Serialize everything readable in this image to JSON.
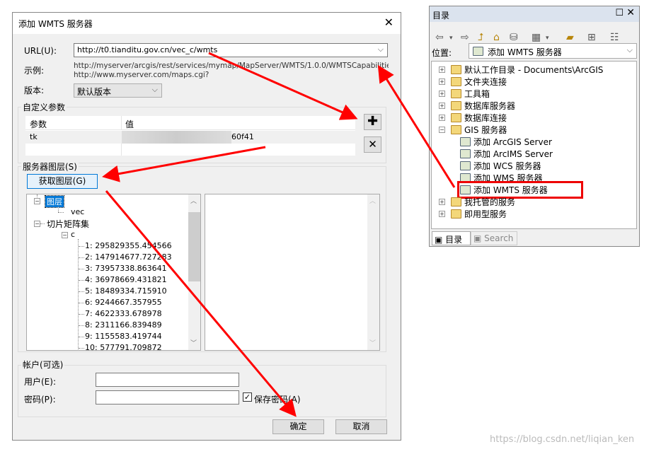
{
  "dialog": {
    "title": "添加 WMTS 服务器",
    "url_label": "URL(U):",
    "url_value": "http://t0.tianditu.gov.cn/vec_c/wmts",
    "example_label": "示例:",
    "example_lines": [
      "http://myserver/arcgis/rest/services/mymap/MapServer/WMTS/1.0.0/WMTSCapabilities.xml",
      "http://www.myserver.com/maps.cgi?"
    ],
    "version_label": "版本:",
    "version_value": "默认版本",
    "custom_params": {
      "title": "自定义参数",
      "columns": [
        "参数",
        "值"
      ],
      "rows": [
        {
          "param": "tk",
          "value": "60f41"
        }
      ],
      "add_icon": "plus-icon",
      "delete_icon": "x-icon"
    },
    "layers": {
      "title": "服务器图层(S)",
      "get_layers_button": "获取图层(G)",
      "tree": {
        "layers_node": "图层",
        "layer_child": "vec",
        "matrix_sets_node": "切片矩阵集",
        "matrix_set": "c",
        "levels": [
          "1: 295829355.454566",
          "2: 147914677.727283",
          "3: 73957338.863641",
          "4: 36978669.431821",
          "5: 18489334.715910",
          "6: 9244667.357955",
          "7: 4622333.678978",
          "8: 2311166.839489",
          "9: 1155583.419744",
          "10: 577791.709872"
        ]
      }
    },
    "account": {
      "title": "帐户(可选)",
      "user_label": "用户(E):",
      "user_value": "",
      "password_label": "密码(P):",
      "password_value": "",
      "save_password_label": "保存密码(A)",
      "save_password_checked": true
    },
    "ok_button": "确定",
    "cancel_button": "取消"
  },
  "catalog": {
    "title": "目录",
    "location_label": "位置:",
    "location_value": "添加 WMTS 服务器",
    "items": [
      {
        "label": "默认工作目录 - Documents\\ArcGIS",
        "expander": "+"
      },
      {
        "label": "文件夹连接",
        "expander": "+"
      },
      {
        "label": "工具箱",
        "expander": "+"
      },
      {
        "label": "数据库服务器",
        "expander": "+"
      },
      {
        "label": "数据库连接",
        "expander": "+"
      },
      {
        "label": "GIS 服务器",
        "expander": "−"
      },
      {
        "label": "添加 ArcGIS Server"
      },
      {
        "label": "添加 ArcIMS Server"
      },
      {
        "label": "添加 WCS 服务器"
      },
      {
        "label": "添加 WMS 服务器"
      },
      {
        "label": "添加 WMTS 服务器",
        "highlighted": true
      },
      {
        "label": "我托管的服务",
        "expander": "+"
      },
      {
        "label": "即用型服务",
        "expander": "+"
      }
    ],
    "tabs": [
      "目录",
      "Search"
    ]
  },
  "watermark": "https://blog.csdn.net/liqian_ken",
  "colors": {
    "annotation": "#ff0000",
    "selection": "#0078d7",
    "button_hover": "#e5f1fb"
  }
}
